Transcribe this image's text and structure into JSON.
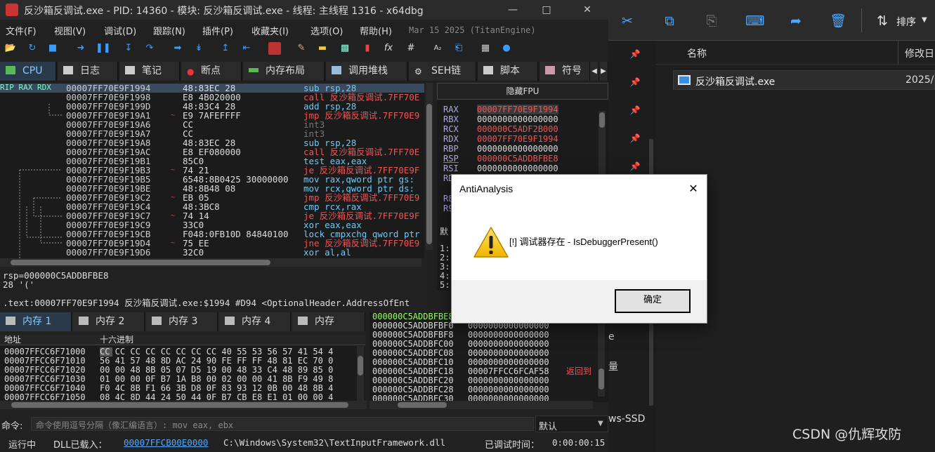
{
  "debugger": {
    "title": "反沙箱反调试.exe - PID: 14360 - 模块: 反沙箱反调试.exe - 线程: 主线程 1316 - x64dbg",
    "menu": [
      "文件(F)",
      "视图(V)",
      "调试(D)",
      "跟踪(N)",
      "插件(P)",
      "收藏夹(I)",
      "选项(O)",
      "帮助(H)"
    ],
    "menu_date": "Mar 15 2025 (TitanEngine)",
    "tabs": [
      "CPU",
      "日志",
      "笔记",
      "断点",
      "内存布局",
      "调用堆栈",
      "SEH链",
      "脚本",
      "符号"
    ],
    "reg_labels": "RIP RAX RDX",
    "disasm": [
      {
        "addr": "00007FF70E9F1994",
        "bytes": "48:83EC 28",
        "dis": "sub rsp,28"
      },
      {
        "addr": "00007FF70E9F1998",
        "bytes": "E8 4B020000",
        "dis": "call 反沙箱反调试.7FF70E"
      },
      {
        "addr": "00007FF70E9F199D",
        "bytes": "48:83C4 28",
        "dis": "add rsp,28"
      },
      {
        "addr": "00007FF70E9F19A1",
        "bytes": "E9 7AFEFFFF",
        "dis": "jmp 反沙箱反调试.7FF70E9"
      },
      {
        "addr": "00007FF70E9F19A6",
        "bytes": "CC",
        "dis": "int3"
      },
      {
        "addr": "00007FF70E9F19A7",
        "bytes": "CC",
        "dis": "int3"
      },
      {
        "addr": "00007FF70E9F19A8",
        "bytes": "48:83EC 28",
        "dis": "sub rsp,28"
      },
      {
        "addr": "00007FF70E9F19AC",
        "bytes": "E8 EF080000",
        "dis": "call 反沙箱反调试.7FF70E"
      },
      {
        "addr": "00007FF70E9F19B1",
        "bytes": "85C0",
        "dis": "test eax,eax"
      },
      {
        "addr": "00007FF70E9F19B3",
        "bytes": "74 21",
        "dis": "je 反沙箱反调试.7FF70E9F"
      },
      {
        "addr": "00007FF70E9F19B5",
        "bytes": "6548:8B0425 30000000",
        "dis": "mov rax,qword ptr gs:"
      },
      {
        "addr": "00007FF70E9F19BE",
        "bytes": "48:8B48 08",
        "dis": "mov rcx,qword ptr ds:"
      },
      {
        "addr": "00007FF70E9F19C2",
        "bytes": "EB 05",
        "dis": "jmp 反沙箱反调试.7FF70E9"
      },
      {
        "addr": "00007FF70E9F19C4",
        "bytes": "48:3BC8",
        "dis": "cmp rcx,rax"
      },
      {
        "addr": "00007FF70E9F19C7",
        "bytes": "74 14",
        "dis": "je 反沙箱反调试.7FF70E9F"
      },
      {
        "addr": "00007FF70E9F19C9",
        "bytes": "33C0",
        "dis": "xor eax,eax"
      },
      {
        "addr": "00007FF70E9F19CB",
        "bytes": "F048:0FB10D 84840100",
        "dis": "lock cmpxchg qword ptr"
      },
      {
        "addr": "00007FF70E9F19D4",
        "bytes": "75 EE",
        "dis": "jne 反沙箱反调试.7FF70E9"
      },
      {
        "addr": "00007FF70E9F19D6",
        "bytes": "32C0",
        "dis": "xor al,al"
      }
    ],
    "fpu_header": "隐藏FPU",
    "registers": [
      {
        "n": "RAX",
        "v": "00007FF70E9F1994"
      },
      {
        "n": "RBX",
        "v": "0000000000000000"
      },
      {
        "n": "RCX",
        "v": "000000C5ADF2B000"
      },
      {
        "n": "RDX",
        "v": "00007FF70E9F1994"
      },
      {
        "n": "RBP",
        "v": "0000000000000000"
      },
      {
        "n": "RSP",
        "v": "000000C5ADDBFBE8"
      },
      {
        "n": "RSI",
        "v": "0000000000000000"
      },
      {
        "n": "RDI",
        "v": ""
      }
    ],
    "reg_partial": [
      "R8",
      "R9"
    ],
    "side_labels": [
      "默",
      "1:",
      "2:",
      "3:",
      "4:",
      "5:"
    ],
    "info": [
      "rsp=000000C5ADDBFBE8",
      "28 '('"
    ],
    "info_line": ".text:00007FF70E9F1994 反沙箱反调试.exe:$1994 #D94 <OptionalHeader.AddressOfEnt",
    "mem_tabs": [
      "内存 1",
      "内存 2",
      "内存 3",
      "内存 4",
      "内存"
    ],
    "dump_headers": [
      "地址",
      "十六进制"
    ],
    "dump_rows": [
      {
        "a": "00007FFCC6F71000",
        "h": "CC CC CC CC CC CC CC CC 40 55 53 56 57 41 54 4"
      },
      {
        "a": "00007FFCC6F71010",
        "h": "56 41 57 48 8D AC 24 90 FE FF FF 48 81 EC 70 0"
      },
      {
        "a": "00007FFCC6F71020",
        "h": "00 00 48 8B 05 07 D5 19 00 48 33 C4 48 89 85 0"
      },
      {
        "a": "00007FFCC6F71030",
        "h": "01 00 00 0F B7 1A B8 00 02 00 00 41 8B F9 49 8"
      },
      {
        "a": "00007FFCC6F71040",
        "h": "F0 4C 8B F1 66 3B D8 0F 83 93 12 0B 00 48 8B 4"
      },
      {
        "a": "00007FFCC6F71050",
        "h": "08 4C 8D 44 24 50 44 0F B7 CB E8 E1 01 00 00 4"
      }
    ],
    "stack_rows": [
      {
        "a": "000000C5ADDBFBE8",
        "v": ""
      },
      {
        "a": "000000C5ADDBFBF0",
        "v": "0000000000000000"
      },
      {
        "a": "000000C5ADDBFBF8",
        "v": "0000000000000000"
      },
      {
        "a": "000000C5ADDBFC00",
        "v": "0000000000000000"
      },
      {
        "a": "000000C5ADDBFC08",
        "v": "0000000000000000"
      },
      {
        "a": "000000C5ADDBFC10",
        "v": "0000000000000000"
      },
      {
        "a": "000000C5ADDBFC18",
        "v": "00007FFCC6FCAF58"
      },
      {
        "a": "000000C5ADDBFC20",
        "v": "0000000000000000"
      },
      {
        "a": "000000C5ADDBFC28",
        "v": "0000000000000000"
      },
      {
        "a": "000000C5ADDBFC30",
        "v": "0000000000000000"
      }
    ],
    "stack_comment": "返回到",
    "cmd_label": "命令:",
    "cmd_placeholder": "命令使用逗号分隔（像汇编语言）: mov eax, ebx",
    "cmd_select": "默认",
    "status_running": "运行中",
    "status_dll": "DLL已载入：",
    "status_dll_addr": "00007FFCB00E0000",
    "status_dll_path": "C:\\Windows\\System32\\TextInputFramework.dll",
    "status_time_label": "已调试时间：",
    "status_time": "0:00:00:15"
  },
  "explorer": {
    "sort_label": "排序",
    "col_name": "名称",
    "col_date": "修改日",
    "file_name": "反沙箱反调试.exe",
    "file_date": "2025/",
    "side_text": "ws-SSD",
    "side_partial_1": "e",
    "side_partial_2": "量"
  },
  "dialog": {
    "title": "AntiAnalysis",
    "message": "[!] 调试器存在 - IsDebuggerPresent()",
    "ok": "确定"
  },
  "watermark": "CSDN @仇辉攻防"
}
